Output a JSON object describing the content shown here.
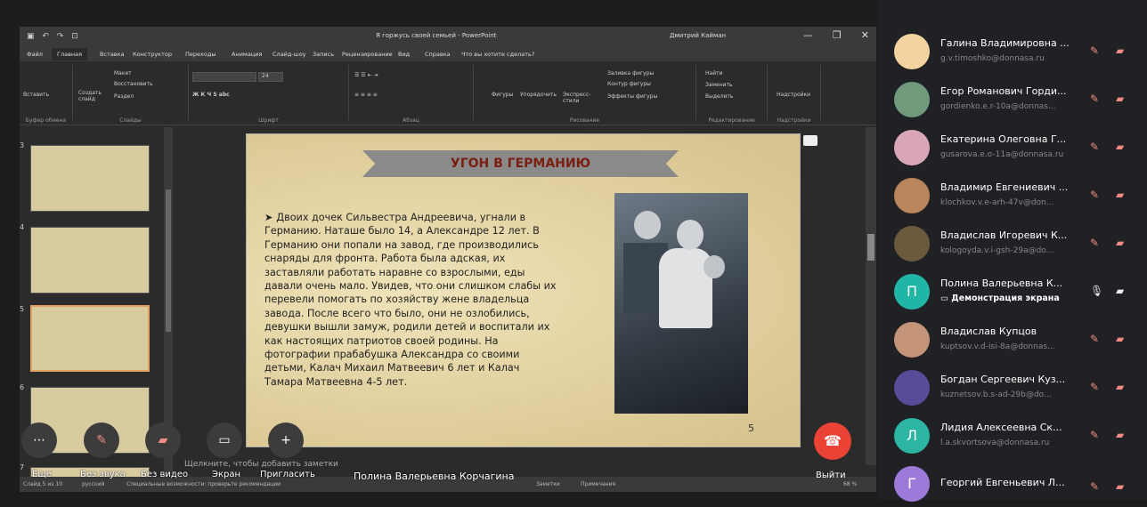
{
  "powerpoint": {
    "title": "Я горжусь своей семьей - PowerPoint",
    "user": "Дмитрий Кайман",
    "tabs": [
      "Файл",
      "Главная",
      "Вставка",
      "Конструктор",
      "Переходы",
      "Анимация",
      "Слайд-шоу",
      "Запись",
      "Рецензирование",
      "Вид",
      "Справка",
      "Что вы хотите сделать?"
    ],
    "ribbon": {
      "paste": "Вставить",
      "clipboard": "Буфер обмена",
      "layout": "Макет",
      "reset": "Восстановить",
      "create_slide": "Создать слайд",
      "section": "Раздел",
      "slides": "Слайды",
      "font_size": "24",
      "font_group": "Шрифт",
      "paragraph_group": "Абзац",
      "shapes": "Фигуры",
      "arrange": "Упорядочить",
      "express": "Экспресс-стили",
      "fill": "Заливка фигуры",
      "outline": "Контур фигуры",
      "effects": "Эффекты фигуры",
      "drawing_group": "Рисование",
      "find": "Найти",
      "replace": "Заменить",
      "select": "Выделить",
      "editing_group": "Редактирование",
      "addins": "Надстройки",
      "addins_group": "Надстройки"
    },
    "thumbnails": [
      "3",
      "4",
      "5",
      "6",
      "7"
    ],
    "slide": {
      "title": "УГОН В ГЕРМАНИЮ",
      "bullet": "➤",
      "text": "Двоих дочек Сильвестра Андреевича, угнали в Германию. Наташе было 14, а Александре 12 лет. В Германию они попали на завод, где производились снаряды для фронта. Работа была адская, их заставляли работать наравне со взрослыми, еды давали очень мало. Увидев, что они слишком слабы их перевели помогать по хозяйству жене владельца завода. После всего что было, они не озлобились, девушки вышли замуж, родили детей и воспитали их как настоящих патриотов своей родины. На фотографии прабабушка Александра со своими детьми, Калач Михаил Матвеевич 6 лет и Калач Тамара Матвеевна 4-5 лет.",
      "number": "5"
    },
    "notes_placeholder": "Щелкните, чтобы добавить заметки",
    "status": {
      "slide": "Слайд 5 из 10",
      "lang": "русский",
      "accessibility": "Специальные возможности: проверьте рекомендации",
      "notes": "Заметки",
      "comments": "Примечания",
      "zoom": "68 %"
    }
  },
  "call": {
    "controls": [
      {
        "icon": "more-icon",
        "label": "Еще"
      },
      {
        "icon": "mic-off-icon",
        "label": "Без звука"
      },
      {
        "icon": "camera-off-icon",
        "label": "Без видео"
      },
      {
        "icon": "screen-icon",
        "label": "Экран"
      },
      {
        "icon": "add-icon",
        "label": "Пригласить"
      }
    ],
    "presenter": "Полина Валерьевна Корчагина",
    "exit_label": "Выйти"
  },
  "participants": [
    {
      "name": "Галина Владимировна ...",
      "email": "g.v.timoshko@donnasa.ru",
      "color": "#f4d3a0",
      "mic": "off"
    },
    {
      "name": "Егор Романович Горди...",
      "email": "gordienko.e.r-10a@donnas...",
      "color": "#6f9a7c",
      "mic": "off"
    },
    {
      "name": "Екатерина Олеговна Г...",
      "email": "gusarova.e.o-11a@donnasa.ru",
      "color": "#d9a6b8",
      "mic": "off"
    },
    {
      "name": "Владимир Евгениевич ...",
      "email": "klochkov.v.e-arh-47v@don...",
      "color": "#b8865a",
      "mic": "off"
    },
    {
      "name": "Владислав Игоревич К...",
      "email": "kologoyda.v.i-gsh-29a@do...",
      "color": "#6b5a3c",
      "mic": "off"
    },
    {
      "name": "Полина Валерьевна К...",
      "share": "Демонстрация экрана",
      "color": "#1fb6a6",
      "letter": "П",
      "mic": "on"
    },
    {
      "name": "Владислав Купцов",
      "email": "kuptsov.v.d-isi-8a@donnas...",
      "color": "#c49478",
      "mic": "off"
    },
    {
      "name": "Богдан Сергеевич Куз...",
      "email": "kuznetsov.b.s-ad-29b@do...",
      "color": "#5a4a9a",
      "mic": "off"
    },
    {
      "name": "Лидия Алексеевна Ск...",
      "email": "l.a.skvortsova@donnasa.ru",
      "color": "#2bb5a2",
      "letter": "Л",
      "mic": "off"
    },
    {
      "name": "Георгий Евгеньевич Л...",
      "email": "",
      "color": "#9d7ad9",
      "letter": "Г",
      "mic": "off"
    }
  ]
}
